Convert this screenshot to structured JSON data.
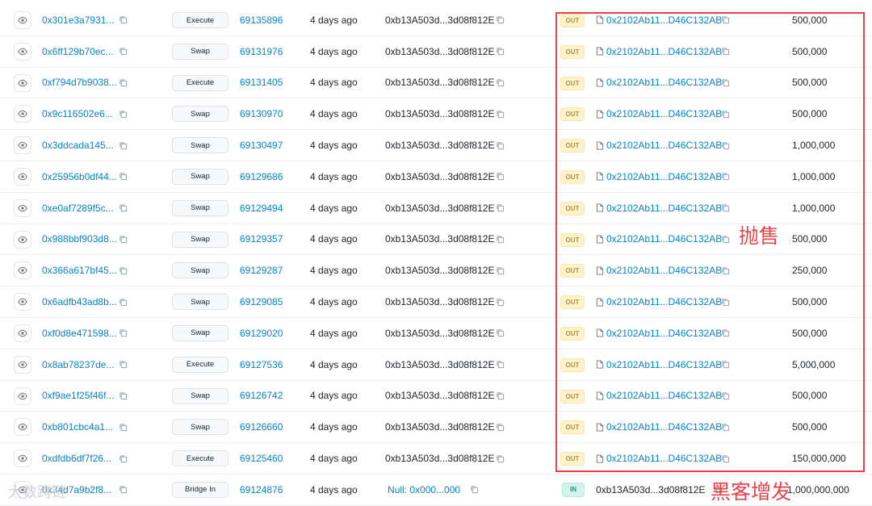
{
  "rows": [
    {
      "hash": "0x301e3a7931...",
      "method": "Execute",
      "block": "69135896",
      "age": "4 days ago",
      "from": "0xb13A503d...3d08f812E",
      "direction": "OUT",
      "to": "0x2102Ab11...D46C132AB",
      "quantity": "500,000"
    },
    {
      "hash": "0x6ff129b70ec...",
      "method": "Swap",
      "block": "69131976",
      "age": "4 days ago",
      "from": "0xb13A503d...3d08f812E",
      "direction": "OUT",
      "to": "0x2102Ab11...D46C132AB",
      "quantity": "500,000"
    },
    {
      "hash": "0xf794d7b9038...",
      "method": "Execute",
      "block": "69131405",
      "age": "4 days ago",
      "from": "0xb13A503d...3d08f812E",
      "direction": "OUT",
      "to": "0x2102Ab11...D46C132AB",
      "quantity": "500,000"
    },
    {
      "hash": "0x9c116502e6...",
      "method": "Swap",
      "block": "69130970",
      "age": "4 days ago",
      "from": "0xb13A503d...3d08f812E",
      "direction": "OUT",
      "to": "0x2102Ab11...D46C132AB",
      "quantity": "500,000"
    },
    {
      "hash": "0x3ddcada145...",
      "method": "Swap",
      "block": "69130497",
      "age": "4 days ago",
      "from": "0xb13A503d...3d08f812E",
      "direction": "OUT",
      "to": "0x2102Ab11...D46C132AB",
      "quantity": "1,000,000"
    },
    {
      "hash": "0x25956b0df44...",
      "method": "Swap",
      "block": "69129686",
      "age": "4 days ago",
      "from": "0xb13A503d...3d08f812E",
      "direction": "OUT",
      "to": "0x2102Ab11...D46C132AB",
      "quantity": "1,000,000"
    },
    {
      "hash": "0xe0af7289f5c...",
      "method": "Swap",
      "block": "69129494",
      "age": "4 days ago",
      "from": "0xb13A503d...3d08f812E",
      "direction": "OUT",
      "to": "0x2102Ab11...D46C132AB",
      "quantity": "1,000,000"
    },
    {
      "hash": "0x988bbf903d8...",
      "method": "Swap",
      "block": "69129357",
      "age": "4 days ago",
      "from": "0xb13A503d...3d08f812E",
      "direction": "OUT",
      "to": "0x2102Ab11...D46C132AB",
      "quantity": "500,000"
    },
    {
      "hash": "0x366a617bf45...",
      "method": "Swap",
      "block": "69129287",
      "age": "4 days ago",
      "from": "0xb13A503d...3d08f812E",
      "direction": "OUT",
      "to": "0x2102Ab11...D46C132AB",
      "quantity": "250,000"
    },
    {
      "hash": "0x6adfb43ad8b...",
      "method": "Swap",
      "block": "69129085",
      "age": "4 days ago",
      "from": "0xb13A503d...3d08f812E",
      "direction": "OUT",
      "to": "0x2102Ab11...D46C132AB",
      "quantity": "500,000"
    },
    {
      "hash": "0xf0d8e471598...",
      "method": "Swap",
      "block": "69129020",
      "age": "4 days ago",
      "from": "0xb13A503d...3d08f812E",
      "direction": "OUT",
      "to": "0x2102Ab11...D46C132AB",
      "quantity": "500,000"
    },
    {
      "hash": "0x8ab78237de...",
      "method": "Execute",
      "block": "69127536",
      "age": "4 days ago",
      "from": "0xb13A503d...3d08f812E",
      "direction": "OUT",
      "to": "0x2102Ab11...D46C132AB",
      "quantity": "5,000,000"
    },
    {
      "hash": "0xf9ae1f25f46f...",
      "method": "Swap",
      "block": "69126742",
      "age": "4 days ago",
      "from": "0xb13A503d...3d08f812E",
      "direction": "OUT",
      "to": "0x2102Ab11...D46C132AB",
      "quantity": "500,000"
    },
    {
      "hash": "0xb801cbc4a1...",
      "method": "Swap",
      "block": "69126660",
      "age": "4 days ago",
      "from": "0xb13A503d...3d08f812E",
      "direction": "OUT",
      "to": "0x2102Ab11...D46C132AB",
      "quantity": "500,000"
    },
    {
      "hash": "0xdfdb6df7f26...",
      "method": "Execute",
      "block": "69125460",
      "age": "4 days ago",
      "from": "0xb13A503d...3d08f812E",
      "direction": "OUT",
      "to": "0x2102Ab11...D46C132AB",
      "quantity": "150,000,000"
    },
    {
      "hash": "0x34d7a9b2f8...",
      "method": "Bridge In",
      "block": "69124876",
      "age": "4 days ago",
      "from": "Null: 0x000...000",
      "direction": "IN",
      "to": "0xb13A503d...3d08f812E",
      "quantity": "1,000,000,000"
    }
  ],
  "annotations": {
    "sell_label": "抛售",
    "mint_label": "黑客增发",
    "box_color": "#e8434a"
  },
  "watermark": "大数跨链",
  "colors": {
    "link": "#0784c3",
    "out_badge_bg": "#fff3cd",
    "in_badge_bg": "#d5f3ea"
  }
}
